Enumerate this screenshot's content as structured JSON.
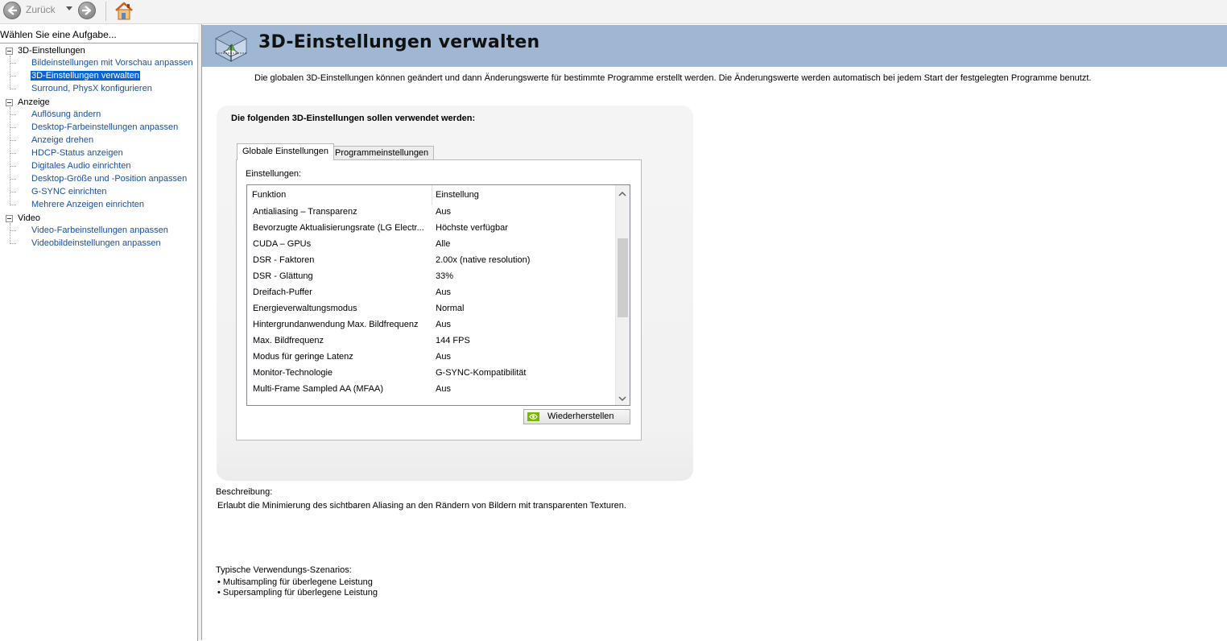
{
  "toolbar": {
    "back_label": "Zurück"
  },
  "sidebar": {
    "heading": "Wählen Sie eine Aufgabe...",
    "categories": [
      {
        "label": "3D-Einstellungen",
        "items": [
          "Bildeinstellungen mit Vorschau anpassen",
          "3D-Einstellungen verwalten",
          "Surround, PhysX konfigurieren"
        ]
      },
      {
        "label": "Anzeige",
        "items": [
          "Auflösung ändern",
          "Desktop-Farbeinstellungen anpassen",
          "Anzeige drehen",
          "HDCP-Status anzeigen",
          "Digitales Audio einrichten",
          "Desktop-Größe und -Position anpassen",
          "G-SYNC einrichten",
          "Mehrere Anzeigen einrichten"
        ]
      },
      {
        "label": "Video",
        "items": [
          "Video-Farbeinstellungen anpassen",
          "Videobildeinstellungen anpassen"
        ]
      }
    ],
    "selected_item": "3D-Einstellungen verwalten"
  },
  "header": {
    "title": "3D-Einstellungen verwalten"
  },
  "intro_text": "Die globalen 3D-Einstellungen können geändert und dann Änderungswerte für bestimmte Programme erstellt werden. Die Änderungswerte werden automatisch bei jedem Start der festgelegten Programme benutzt.",
  "settings": {
    "heading": "Die folgenden 3D-Einstellungen sollen verwendet werden:",
    "tabs": [
      {
        "label": "Globale Einstellungen",
        "active": true
      },
      {
        "label": "Programmeinstellungen",
        "active": false
      }
    ],
    "list_label": "Einstellungen:",
    "columns": [
      "Funktion",
      "Einstellung"
    ],
    "rows": [
      {
        "name": "Antialiasing – Transparenz",
        "value": "Aus"
      },
      {
        "name": "Bevorzugte Aktualisierungsrate (LG Electr...",
        "value": "Höchste verfügbar"
      },
      {
        "name": "CUDA – GPUs",
        "value": "Alle"
      },
      {
        "name": "DSR - Faktoren",
        "value": "2.00x (native resolution)"
      },
      {
        "name": "DSR - Glättung",
        "value": "33%"
      },
      {
        "name": "Dreifach-Puffer",
        "value": "Aus"
      },
      {
        "name": "Energieverwaltungsmodus",
        "value": "Normal"
      },
      {
        "name": "Hintergrundanwendung Max. Bildfrequenz",
        "value": "Aus"
      },
      {
        "name": "Max. Bildfrequenz",
        "value": "144 FPS"
      },
      {
        "name": "Modus für geringe Latenz",
        "value": "Aus"
      },
      {
        "name": "Monitor-Technologie",
        "value": "G-SYNC-Kompatibilität"
      },
      {
        "name": "Multi-Frame Sampled AA (MFAA)",
        "value": "Aus"
      }
    ],
    "restore_label": "Wiederherstellen"
  },
  "description": {
    "title": "Beschreibung:",
    "text": "Erlaubt die Minimierung des sichtbaren Aliasing an den Rändern von Bildern mit transparenten Texturen."
  },
  "usage": {
    "title": "Typische Verwendungs-Szenarios:",
    "items": [
      "Multisampling für überlegene Leistung",
      "Supersampling für überlegene Leistung"
    ]
  },
  "colors": {
    "header_band": "#9fb7d2",
    "selection": "#0a64d6",
    "link": "#1a4fa0",
    "nvidia_green": "#76b900"
  }
}
